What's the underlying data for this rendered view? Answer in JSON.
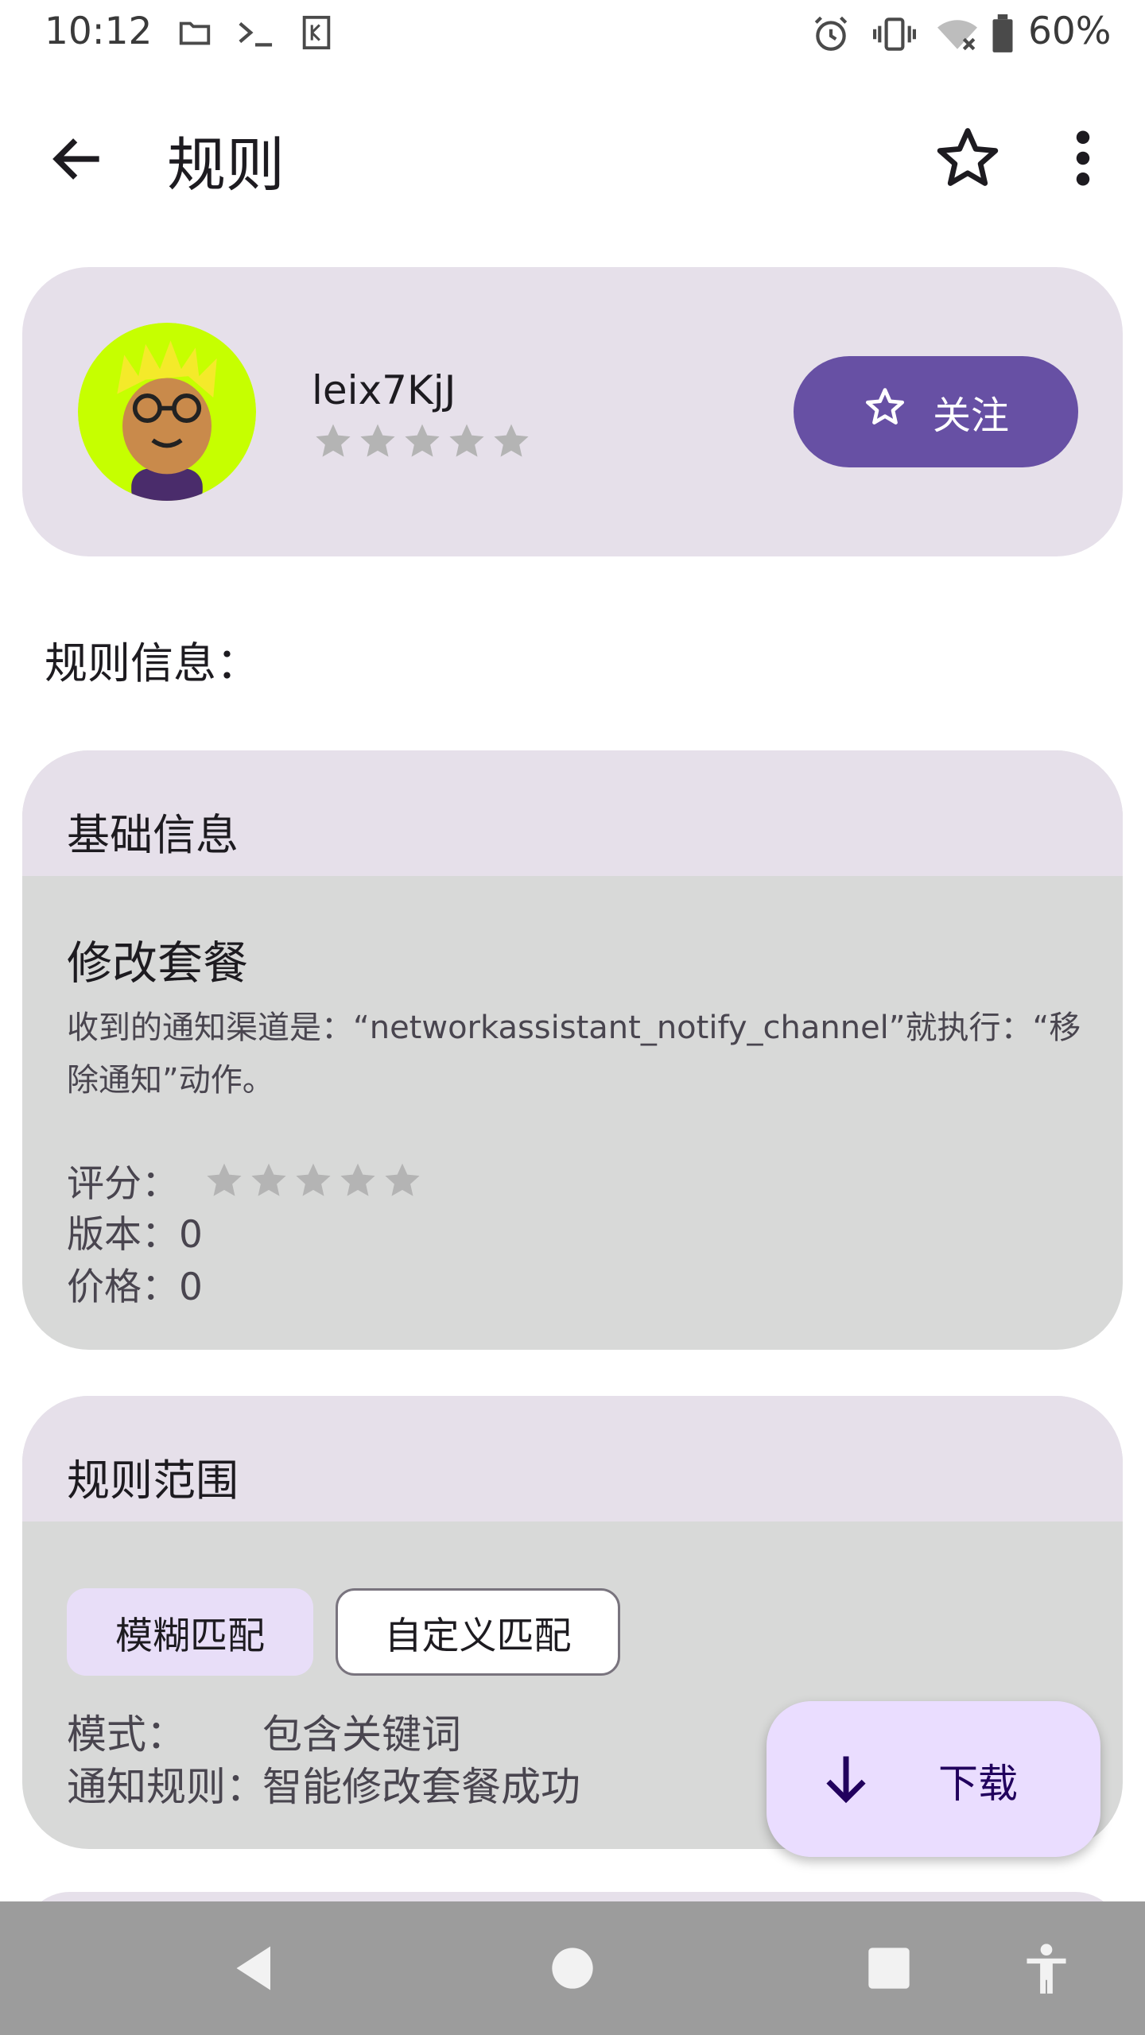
{
  "status_bar": {
    "time": "10:12",
    "battery_text": "60%",
    "icons": [
      "folder-icon",
      "terminal-icon",
      "k-app-icon",
      "alarm-icon",
      "vibrate-icon",
      "wifi-off-icon",
      "battery-icon"
    ]
  },
  "app_bar": {
    "title": "规则",
    "icons": [
      "back-arrow-icon",
      "star-outline-icon",
      "more-vert-icon"
    ]
  },
  "author": {
    "name": "leix7KjJ",
    "rating": 0,
    "rating_max": 5,
    "follow_label": "关注"
  },
  "section_heading": "规则信息：",
  "basic_info": {
    "header": "基础信息",
    "rule_name": "修改套餐",
    "description": "收到的通知渠道是：“networkassistant_notify_channel”就执行：“移除通知”动作。",
    "rating_label": "评分：",
    "rating": 0,
    "rating_max": 5,
    "version_label": "版本：",
    "version_value": "0",
    "price_label": "价格：",
    "price_value": "0"
  },
  "scope": {
    "header": "规则范围",
    "chips": [
      "模糊匹配",
      "自定义匹配"
    ],
    "selected_chip": "模糊匹配",
    "mode_label": "模式：",
    "mode_value": "包含关键词",
    "notify_rule_label": "通知规则：",
    "notify_rule_value": "智能修改套餐成功"
  },
  "fab": {
    "label": "下载"
  },
  "colors": {
    "primary": "#6750a4",
    "card_header": "#e6e0ea",
    "card_body": "#d8d9d8",
    "fab": "#eaddff",
    "star_empty": "#b4b4b4",
    "nav_bar": "#9c9c9c"
  }
}
